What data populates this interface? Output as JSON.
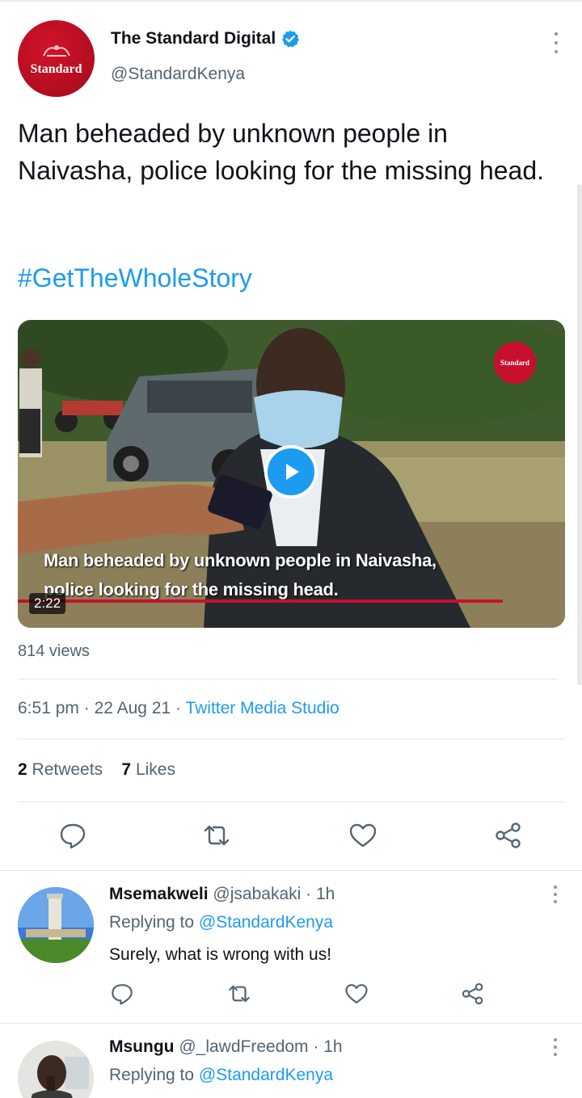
{
  "tweet": {
    "author": {
      "display_name": "The Standard Digital",
      "handle": "@StandardKenya",
      "avatar_text": "Standard",
      "verified": true
    },
    "text": "Man beheaded by unknown people in Naivasha, police looking for the missing head.",
    "hashtag": "#GetTheWholeStory",
    "video": {
      "caption_line1": "Man beheaded by unknown people in Naivasha,",
      "caption_line2": "police looking for the missing head.",
      "duration": "2:22",
      "watermark": "Standard"
    },
    "views": "814 views",
    "time": "6:51 pm",
    "date": "22 Aug 21",
    "source": "Twitter Media Studio",
    "retweets_count": "2",
    "retweets_label": "Retweets",
    "likes_count": "7",
    "likes_label": "Likes"
  },
  "replies": [
    {
      "display_name": "Msemakweli",
      "handle": "@jsabakaki",
      "age": "1h",
      "replying_prefix": "Replying to",
      "replying_to": "@StandardKenya",
      "text": "Surely, what is wrong with us!"
    },
    {
      "display_name": "Msungu",
      "handle": "@_lawdFreedom",
      "age": "1h",
      "replying_prefix": "Replying to",
      "replying_to": "@StandardKenya",
      "text": ""
    }
  ],
  "colors": {
    "accent": "#1d9bf0",
    "brand_red": "#c8102e",
    "muted": "#536471"
  },
  "icons": [
    "verified-badge-icon",
    "more-icon",
    "play-icon",
    "reply-icon",
    "retweet-icon",
    "like-icon",
    "share-icon"
  ]
}
